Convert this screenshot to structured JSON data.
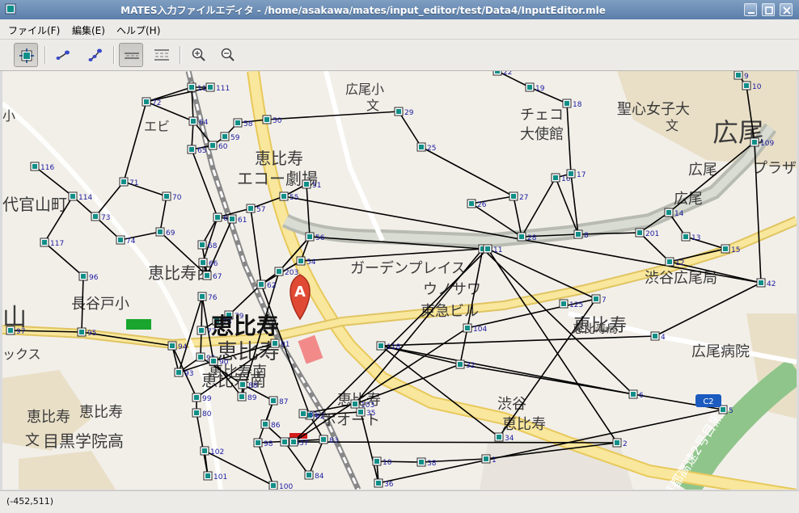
{
  "window": {
    "title": "MATES入力ファイルエディタ  -  /home/asakawa/mates/input_editor/test/Data4/InputEditor.mle"
  },
  "menu": [
    {
      "label": "ファイル(F)"
    },
    {
      "label": "編集(E)"
    },
    {
      "label": "ヘルプ(H)"
    }
  ],
  "toolbar": {
    "buttons": [
      {
        "name": "select-node-tool",
        "icon": "node-select-icon",
        "active": true
      },
      {
        "name": "add-link-tool",
        "icon": "link-add-icon",
        "active": false
      },
      {
        "name": "add-multi-link-tool",
        "icon": "multi-link-icon",
        "active": false
      },
      {
        "name": "lane-view-tool",
        "icon": "lane-single-icon",
        "active": true
      },
      {
        "name": "lane-detail-tool",
        "icon": "lane-multi-icon",
        "active": false
      },
      {
        "name": "zoom-in-button",
        "icon": "zoom-in-icon",
        "active": false
      },
      {
        "name": "zoom-out-button",
        "icon": "zoom-out-icon",
        "active": false
      }
    ]
  },
  "map": {
    "place_labels": [
      "広尾小",
      "文",
      "聖心女子大",
      "文",
      "広尾",
      "チェコ",
      "大使館",
      "恵比寿",
      "エコー劇場",
      "代官山町",
      "広尾",
      "プラザ",
      "広尾",
      "ガーデンプレイス",
      "ウノサワ",
      "東急ビル",
      "恵比寿南",
      "長谷戸小",
      "恵比寿西",
      "恵比寿",
      "広尾病院",
      "渋谷広尾局",
      "山",
      "恵比寿",
      "恵比寿",
      "恵比寿",
      "恵比寿",
      "恵比寿南",
      "恵比寿",
      "ボオート",
      "恵比寿局",
      "渋谷",
      "文",
      "目黒学院高",
      "首都高速2号目黒線",
      "小",
      "エビ",
      "ックス"
    ],
    "station_main_label": "恵比寿",
    "station_marker": "A",
    "node_labels": [
      "10",
      "9",
      "22",
      "19",
      "18",
      "113",
      "111",
      "72",
      "29",
      "58",
      "50",
      "16",
      "17",
      "14",
      "13",
      "15",
      "12",
      "42",
      "201",
      "8",
      "28",
      "27",
      "26",
      "25",
      "109",
      "116",
      "114",
      "73",
      "71",
      "70",
      "69",
      "74",
      "68",
      "67",
      "66",
      "63",
      "57",
      "55",
      "51",
      "56",
      "54",
      "64",
      "60",
      "65",
      "59",
      "61",
      "62",
      "203",
      "79",
      "78",
      "77",
      "76",
      "117",
      "96",
      "95",
      "97",
      "94",
      "93",
      "92",
      "91",
      "90",
      "89",
      "88",
      "87",
      "86",
      "85",
      "84",
      "83",
      "82",
      "81",
      "80",
      "99",
      "98",
      "100",
      "101",
      "102",
      "103",
      "104",
      "32",
      "118",
      "3",
      "6",
      "7",
      "4",
      "5",
      "11",
      "2",
      "1",
      "38",
      "10",
      "36",
      "35",
      "37",
      "34",
      "125",
      "9",
      "206"
    ],
    "highway_label": "C2"
  },
  "status": {
    "coordinates": "(-452,511)"
  },
  "colors": {
    "title_bar": "#6a8bb4",
    "node_fill": "#0f8f87",
    "link_line": "#000000",
    "node_label": "#1a1aa0",
    "marker": "#e04a35"
  }
}
